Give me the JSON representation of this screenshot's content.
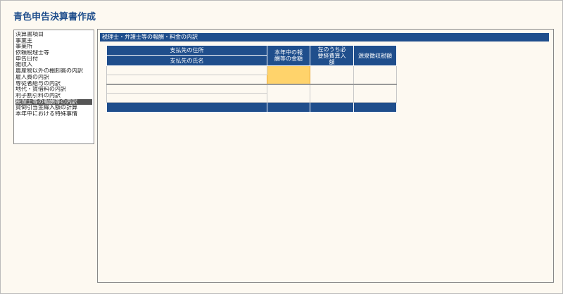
{
  "title": "青色申告決算書作成",
  "sidebar": {
    "items": [
      "決算書項目",
      "事業主",
      "事業所",
      "依頼税理士等",
      "申告日付",
      "雑収入",
      "農産物以外の棚卸高の内訳",
      "雇人費の内訳",
      "専従者給与の内訳",
      "地代・賃借料の内訳",
      "利子割引料の内訳",
      "税理士等の報酬等の内訳",
      "貸倒引当金繰入額の計算",
      "本年中における特殊事情"
    ],
    "selected_index": 11
  },
  "main": {
    "header": "税理士・弁護士等の報酬・料金の内訳",
    "columns": {
      "address": "支払先の住所",
      "name": "支払先の氏名",
      "amount": "本年中の報酬等の金額",
      "expense": "左のうち必要経費算入額",
      "withholding": "源泉徴収税額"
    }
  },
  "colors": {
    "accent": "#1f4e8c",
    "highlight": "#ffd36b"
  }
}
